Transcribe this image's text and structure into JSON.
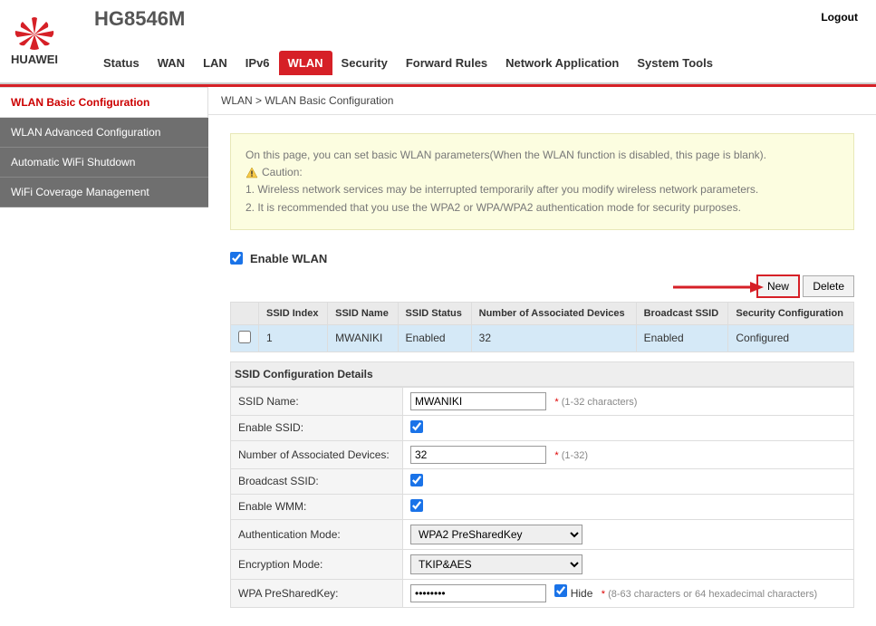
{
  "header": {
    "brand": "HUAWEI",
    "model": "HG8546M",
    "logout": "Logout"
  },
  "nav": {
    "items": [
      "Status",
      "WAN",
      "LAN",
      "IPv6",
      "WLAN",
      "Security",
      "Forward Rules",
      "Network Application",
      "System Tools"
    ],
    "active": "WLAN"
  },
  "sidebar": {
    "items": [
      "WLAN Basic Configuration",
      "WLAN Advanced Configuration",
      "Automatic WiFi Shutdown",
      "WiFi Coverage Management"
    ],
    "active": 0
  },
  "breadcrumb": "WLAN > WLAN Basic Configuration",
  "notice": {
    "intro": "On this page, you can set basic WLAN parameters(When the WLAN function is disabled, this page is blank).",
    "caution_label": "Caution:",
    "line1": "1. Wireless network services may be interrupted temporarily after you modify wireless network parameters.",
    "line2": "2. It is recommended that you use the WPA2 or WPA/WPA2 authentication mode for security purposes."
  },
  "enable": {
    "label": "Enable WLAN",
    "checked": true
  },
  "actions": {
    "new": "New",
    "delete": "Delete"
  },
  "table": {
    "headers": [
      "SSID Index",
      "SSID Name",
      "SSID Status",
      "Number of Associated Devices",
      "Broadcast SSID",
      "Security Configuration"
    ],
    "row": {
      "index": "1",
      "name": "MWANIKI",
      "status": "Enabled",
      "devices": "32",
      "broadcast": "Enabled",
      "security": "Configured"
    }
  },
  "details": {
    "title": "SSID Configuration Details",
    "ssid_name": {
      "label": "SSID Name:",
      "value": "MWANIKI",
      "hint": "(1-32 characters)"
    },
    "enable_ssid": {
      "label": "Enable SSID:",
      "checked": true
    },
    "num_devices": {
      "label": "Number of Associated Devices:",
      "value": "32",
      "hint": "(1-32)"
    },
    "broadcast": {
      "label": "Broadcast SSID:",
      "checked": true
    },
    "wmm": {
      "label": "Enable WMM:",
      "checked": true
    },
    "auth": {
      "label": "Authentication Mode:",
      "value": "WPA2 PreSharedKey"
    },
    "encryption": {
      "label": "Encryption Mode:",
      "value": "TKIP&AES"
    },
    "psk": {
      "label": "WPA PreSharedKey:",
      "value": "••••••••",
      "hide_label": "Hide",
      "hide_checked": true,
      "hint": "(8-63 characters or 64 hexadecimal characters)"
    }
  }
}
